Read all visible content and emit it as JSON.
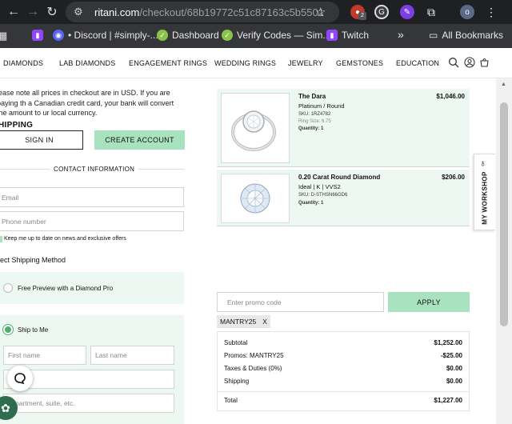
{
  "browser": {
    "url_domain": "ritani.com",
    "url_path": "/checkout/68b19772c51c87163c5b5501",
    "ext_badge": "2",
    "profile_initial": "o",
    "bookmarks": [
      {
        "label": "",
        "color": "#9146ff"
      },
      {
        "label": "• Discord | #simply-...",
        "color": "#5865f2"
      },
      {
        "label": "Dashboard",
        "color": "#8bc34a"
      },
      {
        "label": "Verify Codes — Sim...",
        "color": "#8bc34a"
      },
      {
        "label": "Twitch",
        "color": "#9146ff"
      }
    ],
    "overflow": "»",
    "all_bookmarks": "All Bookmarks"
  },
  "nav": {
    "items": [
      "DIAMONDS",
      "LAB DIAMONDS",
      "ENGAGEMENT RINGS",
      "WEDDING RINGS",
      "JEWELRY",
      "GEMSTONES",
      "EDUCATION"
    ]
  },
  "checkout": {
    "notice": "lease note all prices in checkout are in USD. If you are paying th a Canadian credit card, your bank will convert the amount to ur local currency.",
    "shipping_heading": "HIPPING",
    "sign_in": "SIGN IN",
    "create_account": "CREATE ACCOUNT",
    "contact_heading": "CONTACT INFORMATION",
    "email_placeholder": "Email",
    "phone_placeholder": "Phone number",
    "newsletter_label": "Keep me up to date on news and exclusive offers",
    "shipping_method_heading": "lect Shipping Method",
    "free_preview_label": "Free Preview with a Diamond Pro",
    "ship_to_me_label": "Ship to Me",
    "first_name_placeholder": "First name",
    "last_name_placeholder": "Last name",
    "apartment_placeholder": "partment, suite, etc."
  },
  "cart": {
    "items": [
      {
        "title": "The Dara",
        "sub": "Platinum / Round",
        "sku": "SKU: 1RZ4782",
        "size": "Ring Size: 6.75",
        "qty": "Quantity: 1",
        "price": "$1,046.00"
      },
      {
        "title": "0.20 Carat Round Diamond",
        "sub": "Ideal | K | VVS2",
        "sku": "SKU: D-STHSN66GD6",
        "qty": "Quantity: 1",
        "price": "$206.00"
      }
    ],
    "promo_placeholder": "Enter promo code",
    "apply": "APPLY",
    "applied_code": "MANTRY25",
    "remove": "X",
    "summary": [
      {
        "label": "Subtotal",
        "value": "$1,252.00"
      },
      {
        "label": "Promos: MANTRY25",
        "value": "-$25.00"
      },
      {
        "label": "Taxes & Duties (0%)",
        "value": "$0.00"
      },
      {
        "label": "Shipping",
        "value": "$0.00"
      }
    ],
    "total_label": "Total",
    "total_value": "$1,227.00"
  },
  "workshop": {
    "label": "MY WORKSHOP"
  }
}
